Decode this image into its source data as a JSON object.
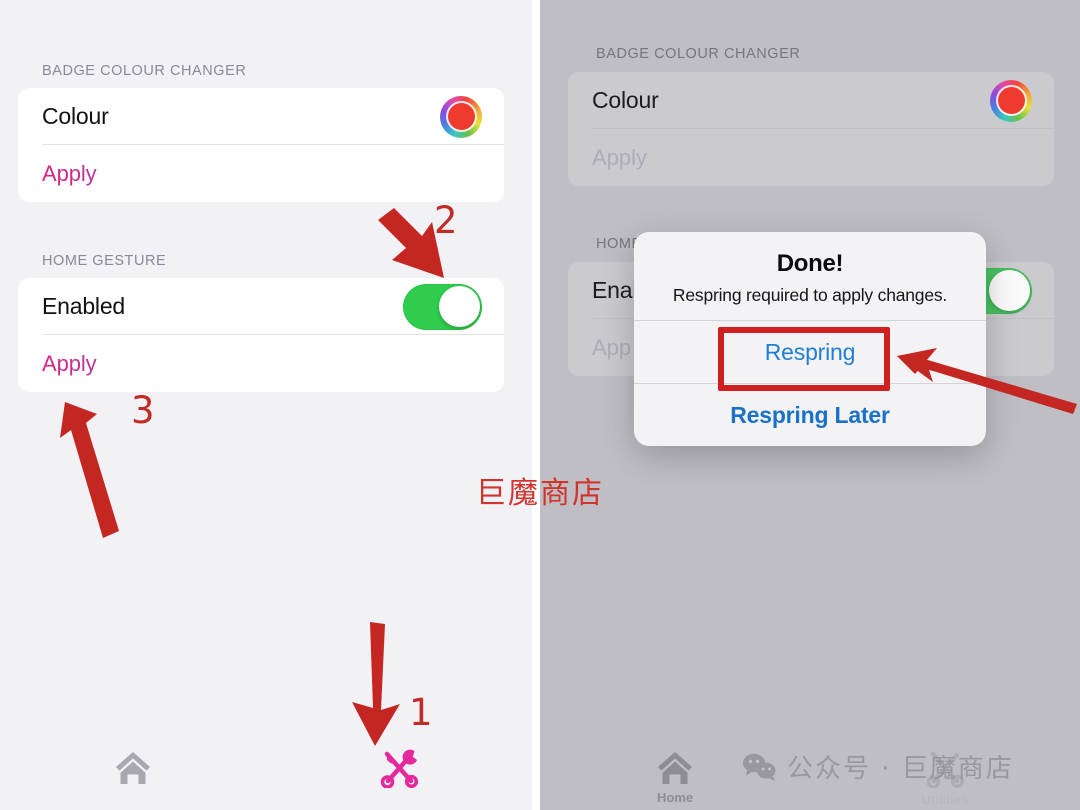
{
  "left_panel": {
    "sections": [
      {
        "header": "BADGE COLOUR CHANGER",
        "rows": [
          {
            "title": "Colour",
            "accessory": "color-wheel",
            "swatch_color": "#ef3b2f"
          },
          {
            "title": "Apply",
            "accessory": "action"
          }
        ]
      },
      {
        "header": "HOME GESTURE",
        "rows": [
          {
            "title": "Enabled",
            "accessory": "toggle",
            "toggle_on": true
          },
          {
            "title": "Apply",
            "accessory": "action"
          }
        ]
      }
    ],
    "tabbar": {
      "home_label": "",
      "utilities_label": ""
    }
  },
  "right_panel": {
    "sections": [
      {
        "header": "BADGE COLOUR CHANGER",
        "rows": [
          {
            "title": "Colour",
            "accessory": "color-wheel"
          },
          {
            "title": "Apply",
            "accessory": "action"
          }
        ]
      },
      {
        "header": "HOME",
        "rows": [
          {
            "title": "Enab",
            "accessory": "toggle"
          },
          {
            "title": "App",
            "accessory": "action"
          }
        ]
      }
    ],
    "tabbar": {
      "home_label": "Home",
      "utilities_label": "Utilities"
    },
    "alert": {
      "title": "Done!",
      "message": "Respring required to apply changes.",
      "primary_button": "Respring",
      "secondary_button": "Respring Later"
    }
  },
  "annotations": {
    "step1": "1",
    "step2": "2",
    "step3": "3",
    "arrow_color": "#c42722",
    "highlight_color": "#cf1f1f"
  },
  "watermarks": {
    "red_text": "巨魔商店",
    "wechat_text": "公众号 · 巨魔商店"
  },
  "colors": {
    "apply_pink": "#d6297f",
    "toggle_green": "#2fcc4d",
    "alert_blue": "#1f7fd4",
    "left_bg": "#f2f1f5",
    "right_bg": "#bfbec4"
  }
}
